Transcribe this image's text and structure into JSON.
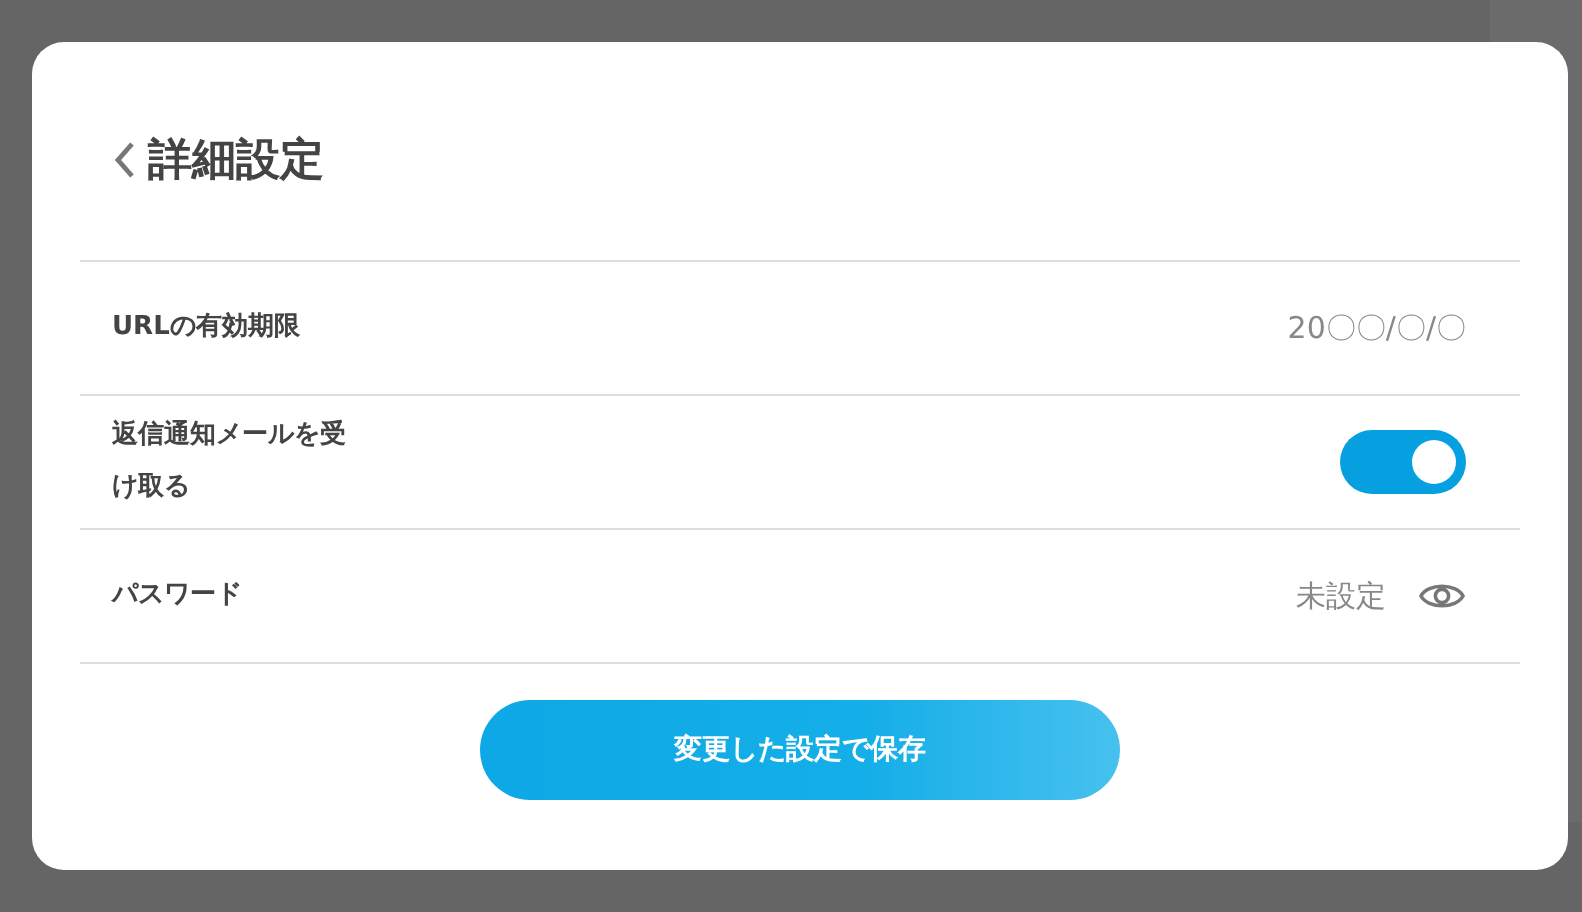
{
  "dialog": {
    "title": "詳細設定"
  },
  "rows": [
    {
      "kind": "value",
      "label": "URLの有効期限",
      "value": "20〇〇/〇/〇"
    },
    {
      "kind": "toggle",
      "label": "返信通知メールを受け取る",
      "on": true
    },
    {
      "kind": "password",
      "label": "パスワード",
      "value": "未設定"
    }
  ],
  "save_button": "変更した設定で保存"
}
